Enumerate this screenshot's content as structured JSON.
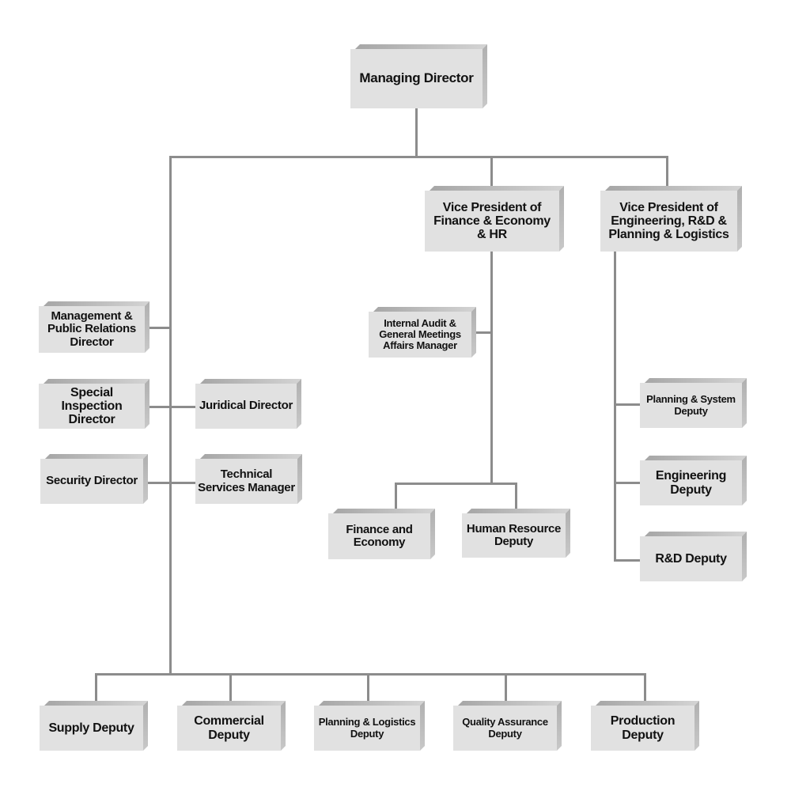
{
  "diagram": {
    "type": "org-chart",
    "line_color": "#8c8c8c",
    "box_face_color": "#e1e1e1",
    "box_bevel_color": "#b0b0b0",
    "nodes": {
      "managing_director": "Managing Director",
      "vp_finance": "Vice President of\nFinance & Economy\n& HR",
      "vp_engineering": "Vice President of\nEngineering, R&D &\nPlanning & Logistics",
      "mgmt_pr_director": "Management &\nPublic Relations\nDirector",
      "special_inspection_director": "Special\nInspection\nDirector",
      "security_director": "Security Director",
      "juridical_director": "Juridical Director",
      "technical_services_manager": "Technical\nServices Manager",
      "internal_audit_manager": "Internal Audit &\nGeneral Meetings\nAffairs Manager",
      "finance_economy": "Finance and\nEconomy",
      "hr_deputy": "Human Resource\nDeputy",
      "planning_system_deputy": "Planning & System\nDeputy",
      "engineering_deputy": "Engineering\nDeputy",
      "rd_deputy": "R&D Deputy",
      "supply_deputy": "Supply Deputy",
      "commercial_deputy": "Commercial\nDeputy",
      "planning_logistics_deputy": "Planning & Logistics\nDeputy",
      "quality_assurance_deputy": "Quality Assurance\nDeputy",
      "production_deputy": "Production\nDeputy"
    },
    "relations": [
      [
        "managing_director",
        "vp_finance"
      ],
      [
        "managing_director",
        "vp_engineering"
      ],
      [
        "managing_director",
        "mgmt_pr_director"
      ],
      [
        "managing_director",
        "special_inspection_director"
      ],
      [
        "managing_director",
        "juridical_director"
      ],
      [
        "managing_director",
        "security_director"
      ],
      [
        "managing_director",
        "technical_services_manager"
      ],
      [
        "managing_director",
        "supply_deputy"
      ],
      [
        "managing_director",
        "commercial_deputy"
      ],
      [
        "managing_director",
        "planning_logistics_deputy"
      ],
      [
        "managing_director",
        "quality_assurance_deputy"
      ],
      [
        "managing_director",
        "production_deputy"
      ],
      [
        "vp_finance",
        "internal_audit_manager"
      ],
      [
        "vp_finance",
        "finance_economy"
      ],
      [
        "vp_finance",
        "hr_deputy"
      ],
      [
        "vp_engineering",
        "planning_system_deputy"
      ],
      [
        "vp_engineering",
        "engineering_deputy"
      ],
      [
        "vp_engineering",
        "rd_deputy"
      ]
    ]
  }
}
